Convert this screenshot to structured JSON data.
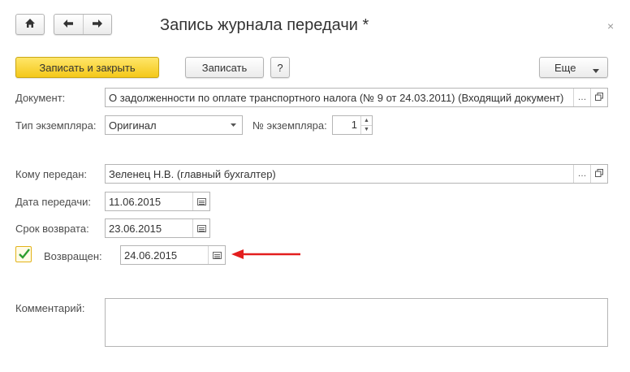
{
  "window": {
    "title": "Запись журнала передачи *",
    "close_glyph": "×"
  },
  "nav": {
    "home_icon": "home-icon",
    "back_icon": "arrow-left-icon",
    "forward_icon": "arrow-right-icon"
  },
  "toolbar": {
    "save_close_label": "Записать и закрыть",
    "save_label": "Записать",
    "help_label": "?",
    "more_label": "Еще"
  },
  "form": {
    "document": {
      "label": "Документ:",
      "value": "О задолженности по оплате транспортного налога (№ 9 от 24.03.2011) (Входящий документ)"
    },
    "copy_type": {
      "label": "Тип экземпляра:",
      "value": "Оригинал"
    },
    "copy_number": {
      "label": "№ экземпляра:",
      "value": "1"
    },
    "recipient": {
      "label": "Кому передан:",
      "value": "Зеленец Н.В. (главный бухгалтер)"
    },
    "transfer_date": {
      "label": "Дата передачи:",
      "value": "11.06.2015"
    },
    "return_deadline": {
      "label": "Срок возврата:",
      "value": "23.06.2015"
    },
    "returned": {
      "label": "Возвращен:",
      "checked": true,
      "date": "24.06.2015"
    },
    "comment": {
      "label": "Комментарий:",
      "value": ""
    }
  },
  "annotation": {
    "arrow_color": "#e31e1e"
  },
  "colors": {
    "primary_button": "#f4c819",
    "check": "#2e9e2e"
  }
}
